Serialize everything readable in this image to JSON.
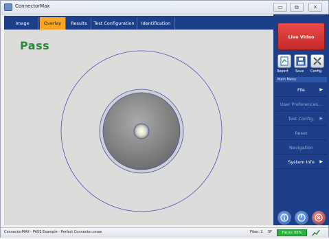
{
  "window": {
    "title": "ConnectorMax",
    "buttons": {
      "minimize": "▭",
      "restore": "⧉",
      "close": "✕"
    }
  },
  "tabs": [
    {
      "label": "Image",
      "active": false
    },
    {
      "label": "Overlay",
      "active": true
    },
    {
      "label": "Results",
      "active": false
    },
    {
      "label": "Test Configuration",
      "active": false
    },
    {
      "label": "Identification",
      "active": false
    }
  ],
  "viewer": {
    "result_label": "Pass",
    "result_color": "#2a8a3a"
  },
  "side_panel": {
    "live_video_label": "Live Video",
    "tools": [
      {
        "label": "Report",
        "icon": "report-icon"
      },
      {
        "label": "Save",
        "icon": "save-icon"
      },
      {
        "label": "Config.",
        "icon": "config-icon"
      }
    ],
    "main_menu_title": "Main Menu",
    "menu_items": [
      {
        "label": "File",
        "arrow": "▶",
        "enabled": true
      },
      {
        "label": "User Preferences...",
        "arrow": "",
        "enabled": false
      },
      {
        "label": "Test Config.",
        "arrow": "▶",
        "enabled": false
      },
      {
        "label": "Reset",
        "arrow": "",
        "enabled": false
      },
      {
        "label": "Navigation",
        "arrow": "",
        "enabled": false
      },
      {
        "label": "System Info",
        "arrow": "▶",
        "enabled": true
      }
    ],
    "bottom_buttons": [
      {
        "icon": "info-icon",
        "color": "#3a78d8"
      },
      {
        "icon": "power-icon",
        "color": "#3a78d8"
      },
      {
        "icon": "stop-icon",
        "color": "#d83a3a"
      }
    ]
  },
  "status": {
    "text": "ConnectorMAX - PASS Example - Perfect Connector.cmax",
    "fiber_label": "Fiber: 1",
    "fiber_suffix": "SF",
    "badge": "Focus: 65%",
    "icon": "signal-icon"
  }
}
